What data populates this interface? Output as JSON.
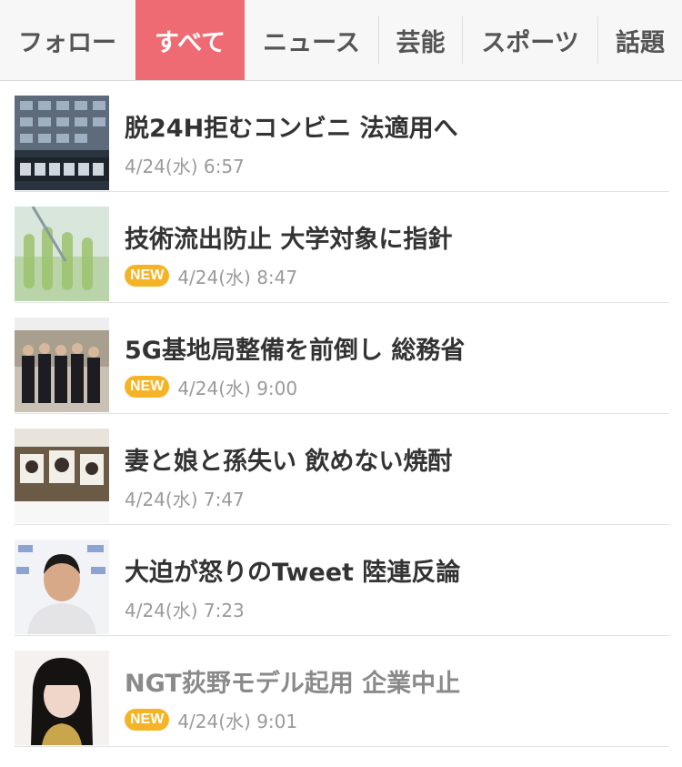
{
  "tabs": [
    {
      "label": "フォロー",
      "active": false
    },
    {
      "label": "すべて",
      "active": true
    },
    {
      "label": "ニュース",
      "active": false
    },
    {
      "label": "芸能",
      "active": false
    },
    {
      "label": "スポーツ",
      "active": false
    },
    {
      "label": "話題",
      "active": false
    }
  ],
  "articles": [
    {
      "title": "脱24H拒むコンビニ 法適用へ",
      "new": false,
      "new_label": "",
      "time": "4/24(水) 6:57",
      "read": false,
      "thumb": "building-sign-photo"
    },
    {
      "title": "技術流出防止 大学対象に指針",
      "new": true,
      "new_label": "NEW",
      "time": "4/24(水) 8:47",
      "read": false,
      "thumb": "lab-test-tubes-photo"
    },
    {
      "title": "5G基地局整備を前倒し 総務省",
      "new": true,
      "new_label": "NEW",
      "time": "4/24(水) 9:00",
      "read": false,
      "thumb": "press-conference-photo"
    },
    {
      "title": "妻と娘と孫失い 飲めない焼酎",
      "new": false,
      "new_label": "",
      "time": "4/24(水) 7:47",
      "read": false,
      "thumb": "family-photos-photo"
    },
    {
      "title": "大迫が怒りのTweet 陸連反論",
      "new": false,
      "new_label": "",
      "time": "4/24(水) 7:23",
      "read": false,
      "thumb": "athlete-portrait-photo"
    },
    {
      "title": "NGT荻野モデル起用 企業中止",
      "new": true,
      "new_label": "NEW",
      "time": "4/24(水) 9:01",
      "read": true,
      "thumb": "idol-portrait-photo"
    }
  ],
  "colors": {
    "active_tab": "#ee6b73",
    "new_badge": "#f5b427",
    "read_title": "#8a8a8a"
  }
}
